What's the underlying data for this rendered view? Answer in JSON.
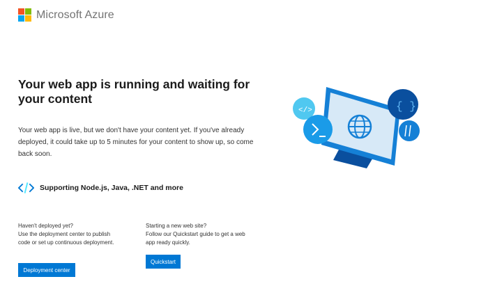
{
  "brand": {
    "name": "Microsoft Azure"
  },
  "main": {
    "title": "Your web app is running and waiting for your content",
    "description": "Your web app is live, but we don't have your content yet. If you've already deployed, it could take up to 5 minutes for your content to show up, so come back soon.",
    "supporting": "Supporting Node.js, Java, .NET and more"
  },
  "left_col": {
    "line1": "Haven't deployed yet?",
    "line2": "Use the deployment center to publish code or set up continuous deployment.",
    "button": "Deployment center"
  },
  "right_col": {
    "line1": "Starting a new web site?",
    "line2": "Follow our Quickstart guide to get a web app ready quickly.",
    "button": "Quickstart"
  },
  "colors": {
    "accent": "#0078d4",
    "logo_text": "#737373"
  },
  "icons": [
    "microsoft-logo-icon",
    "code-brackets-icon",
    "globe-monitor-illustration"
  ]
}
